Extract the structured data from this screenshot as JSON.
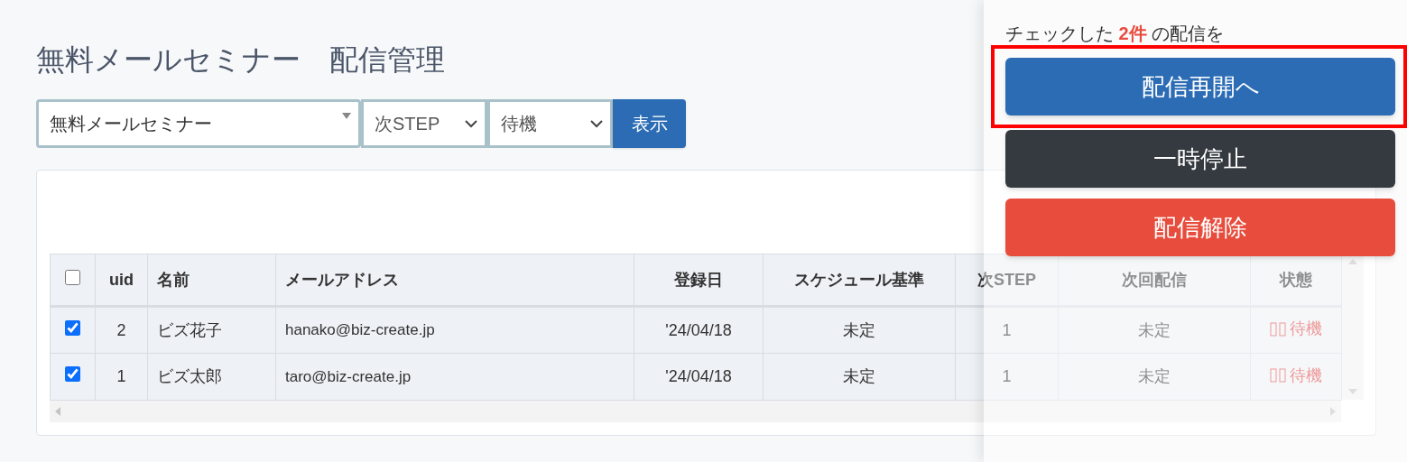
{
  "page_title": "無料メールセミナー　配信管理",
  "filters": [
    {
      "value": "無料メールセミナー",
      "kind": "combo"
    },
    {
      "value": "次STEP",
      "kind": "select"
    },
    {
      "value": "待機",
      "kind": "select"
    }
  ],
  "show_button": "表示",
  "table": {
    "columns": [
      {
        "kind": "checkbox",
        "checked": false
      },
      {
        "label": "uid"
      },
      {
        "label": "名前"
      },
      {
        "label": "メールアドレス"
      },
      {
        "label": "登録日"
      },
      {
        "label": "スケジュール基準"
      },
      {
        "label": "次STEP"
      },
      {
        "label": "次回配信"
      },
      {
        "label": "状態"
      }
    ],
    "rows": [
      {
        "checked": true,
        "uid": "2",
        "name": "ビズ花子",
        "email": "hanako@biz-create.jp",
        "registered": "'24/04/18",
        "schedule": "未定",
        "next_step": "1",
        "next_delivery": "未定",
        "status": "待機"
      },
      {
        "checked": true,
        "uid": "1",
        "name": "ビズ太郎",
        "email": "taro@biz-create.jp",
        "registered": "'24/04/18",
        "schedule": "未定",
        "next_step": "1",
        "next_delivery": "未定",
        "status": "待機"
      }
    ]
  },
  "panel": {
    "prompt": "チェックした **2件** の配信を",
    "buttons": [
      {
        "label": "配信再開へ",
        "kind": "primary",
        "highlighted": true
      },
      {
        "label": "一時停止",
        "kind": "dark",
        "highlighted": false
      },
      {
        "label": "配信解除",
        "kind": "danger",
        "highlighted": false
      }
    ]
  }
}
